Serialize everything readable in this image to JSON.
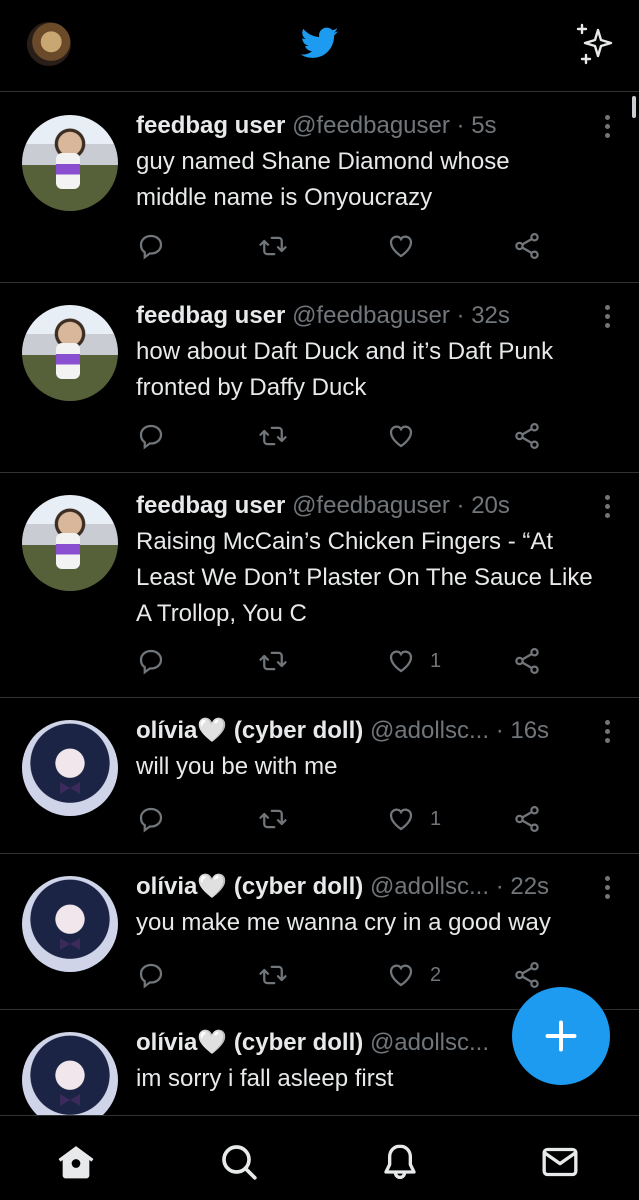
{
  "header": {
    "profile_avatar": "profile-avatar",
    "logo_icon": "twitter-bird-icon",
    "timeline_toggle_icon": "sparkle-icon",
    "brand_color": "#1d9bf0"
  },
  "tweets": [
    {
      "name": "feedbag user",
      "handle": "@feedbaguser",
      "time": "· 5s",
      "text": "guy named Shane Diamond whose middle name is Onyoucrazy",
      "like_count": ""
    },
    {
      "name": "feedbag user",
      "handle": "@feedbaguser",
      "time": "· 32s",
      "text": "how about Daft Duck and it’s Daft Punk fronted by Daffy Duck",
      "like_count": ""
    },
    {
      "name": "feedbag user",
      "handle": "@feedbaguser",
      "time": "· 20s",
      "text": "Raising McCain’s Chicken Fingers - “At Least We Don’t Plaster On The Sauce Like A Trollop, You C",
      "like_count": "1"
    },
    {
      "name": "olívia🤍 (cyber doll)",
      "handle": "@adollsc...",
      "time": "· 16s",
      "text": "will you be with me",
      "like_count": "1"
    },
    {
      "name": "olívia🤍 (cyber doll)",
      "handle": "@adollsc...",
      "time": "· 22s",
      "text": "you make me wanna cry in a good way",
      "like_count": "2"
    },
    {
      "name": "olívia🤍 (cyber doll)",
      "handle": "@adollsc...",
      "time": "",
      "text": "im sorry i fall asleep first",
      "like_count": ""
    }
  ],
  "fab": {
    "icon": "plus-icon"
  },
  "bottom_nav": [
    {
      "icon": "home-icon"
    },
    {
      "icon": "search-icon"
    },
    {
      "icon": "bell-icon"
    },
    {
      "icon": "mail-icon"
    }
  ]
}
